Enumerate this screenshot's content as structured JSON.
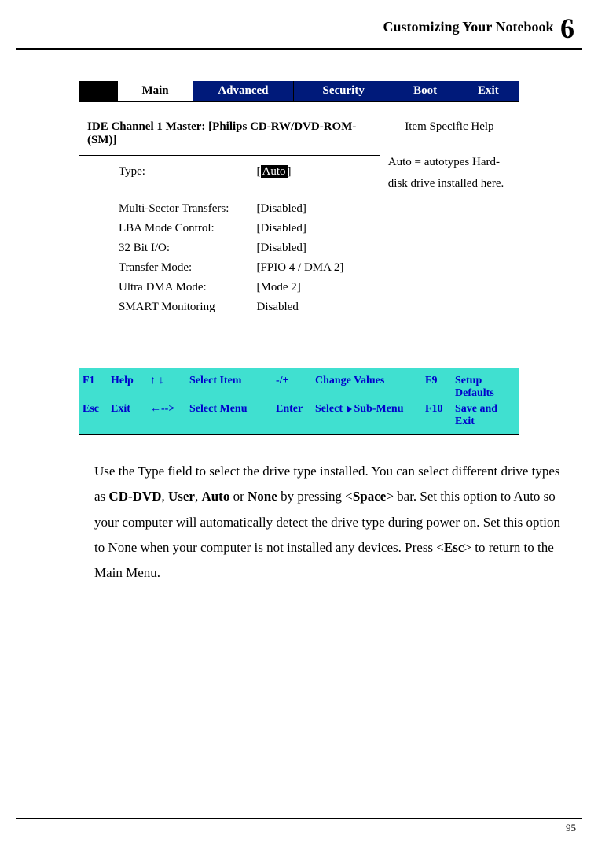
{
  "header": {
    "title": "Customizing Your Notebook",
    "chapter": "6"
  },
  "tabs": {
    "main": "Main",
    "advanced": "Advanced",
    "security": "Security",
    "boot": "Boot",
    "exit": "Exit"
  },
  "ide": {
    "title": "IDE Channel 1 Master: [Philips CD-RW/DVD-ROM-(SM)]"
  },
  "help": {
    "title": "Item Specific Help",
    "body": "Auto = autotypes Hard-disk drive installed here."
  },
  "settings": {
    "rows": [
      {
        "label": "Type:",
        "value": "Auto",
        "highlight": true,
        "bracket": true
      },
      {
        "label": "Multi-Sector Transfers:",
        "value": "[Disabled]"
      },
      {
        "label": "LBA Mode Control:",
        "value": "[Disabled]"
      },
      {
        "label": "32 Bit I/O:",
        "value": "[Disabled]"
      },
      {
        "label": "Transfer Mode:",
        "value": "[FPIO 4 / DMA 2]"
      },
      {
        "label": "Ultra DMA Mode:",
        "value": "[Mode 2]"
      },
      {
        "label": "SMART Monitoring",
        "value": "Disabled"
      }
    ]
  },
  "keys": {
    "row1": {
      "k1": "F1",
      "a1": "Help",
      "arr": "↑ ↓",
      "a2": "Select Item",
      "k2": "-/+",
      "a3": "Change Values",
      "k3": "F9",
      "a4": "Setup Defaults"
    },
    "row2": {
      "k1": "Esc",
      "a1": "Exit",
      "arr": "←-->",
      "a2": "Select Menu",
      "k2": "Enter",
      "a3pre": "Select",
      "a3post": "Sub-Menu",
      "k3": "F10",
      "a4": "Save and Exit"
    }
  },
  "body": {
    "p1a": "Use the Type field to select the drive type installed. You can select different drive types as ",
    "cd": "CD-DVD",
    "c1": ", ",
    "user": "User",
    "c2": ", ",
    "auto": "Auto",
    "c3": " or ",
    "none": "None",
    "p1b": " by pressing <",
    "space": "Space",
    "p1c": "> bar. Set this option to Auto so your computer will automatically detect the drive type during power on. Set this option to None when your computer is not installed any devices. Press <",
    "esc": "Esc",
    "p1d": "> to return to the Main Menu."
  },
  "footer": {
    "page": "95"
  }
}
